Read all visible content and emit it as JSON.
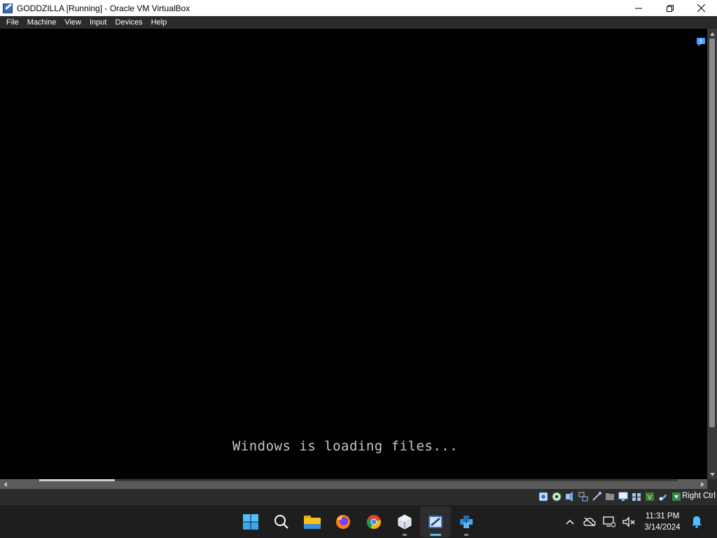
{
  "window": {
    "title": "GODDZILLA [Running] - Oracle VM VirtualBox",
    "app_icon": "virtualbox-icon"
  },
  "menu": {
    "items": [
      {
        "label": "File"
      },
      {
        "label": "Machine"
      },
      {
        "label": "View"
      },
      {
        "label": "Input"
      },
      {
        "label": "Devices"
      },
      {
        "label": "Help"
      }
    ]
  },
  "vm": {
    "boot_message": "Windows is loading files...",
    "background_color": "#000000",
    "text_color": "#c8c8c8"
  },
  "statusbar": {
    "icons": [
      "hard-disk-icon",
      "optical-drive-icon",
      "audio-icon",
      "network-icon",
      "usb-icon",
      "shared-folders-icon",
      "display-icon",
      "video-capture-icon",
      "cpu-icon",
      "mouse-integration-icon",
      "keyboard-icon"
    ],
    "host_key": "Right Ctrl"
  },
  "taskbar": {
    "apps": [
      {
        "name": "start-button",
        "icon": "windows-logo-icon"
      },
      {
        "name": "search-button",
        "icon": "search-icon"
      },
      {
        "name": "file-explorer",
        "icon": "folder-icon"
      },
      {
        "name": "firefox",
        "icon": "firefox-icon"
      },
      {
        "name": "chrome",
        "icon": "chrome-icon"
      },
      {
        "name": "virtualbox-manager",
        "icon": "virtualbox-cube-icon"
      },
      {
        "name": "virtualbox-vm-window",
        "icon": "virtualbox-vm-icon"
      },
      {
        "name": "other-app",
        "icon": "blue-cubes-icon"
      }
    ],
    "clock": {
      "time": "11:31 PM",
      "date": "3/14/2024"
    }
  },
  "colors": {
    "titlebar": "#ffffff",
    "menubar": "#2b2b2b",
    "taskbar": "#1e1e1e",
    "accent": "#4cc2ff"
  }
}
